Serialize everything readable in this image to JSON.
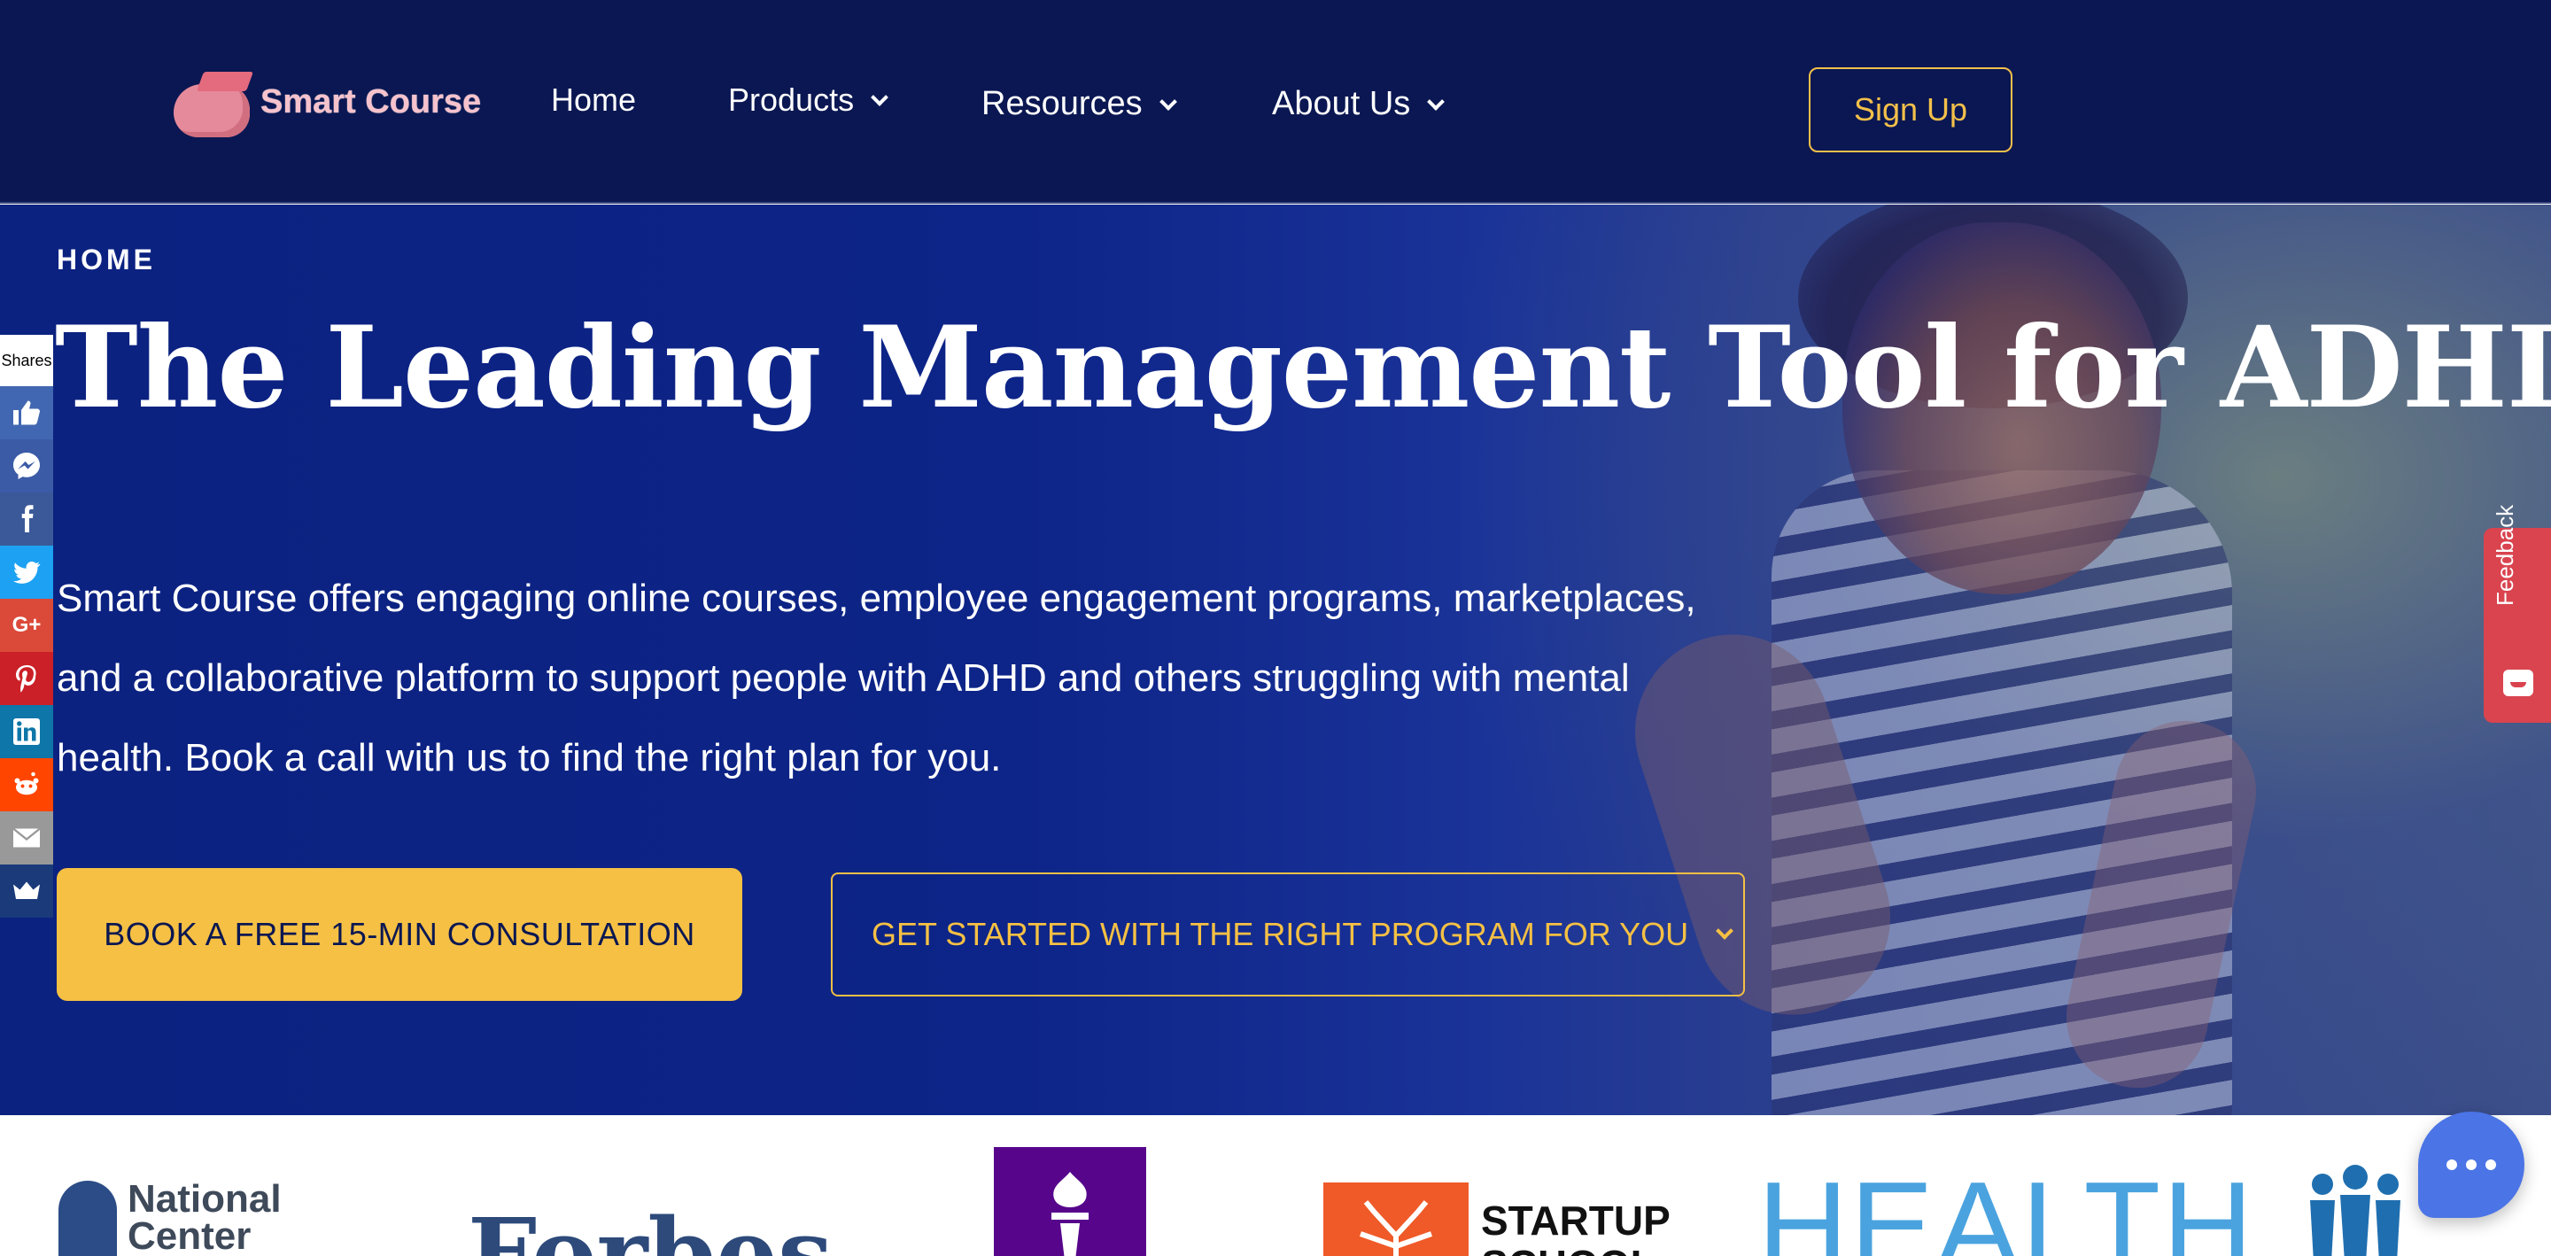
{
  "header": {
    "logo_text": "Smart Course",
    "nav": [
      {
        "label": "Home"
      },
      {
        "label": "Products"
      },
      {
        "label": "Resources"
      },
      {
        "label": "About Us"
      }
    ],
    "signup_label": "Sign Up"
  },
  "hero": {
    "breadcrumb": "HOME",
    "title": "The Leading Management Tool for ADHD",
    "description": "Smart Course offers engaging online courses, employee engagement programs, marketplaces, and a collaborative platform to support people with ADHD and others struggling with mental health. Book a call with us to find the right plan for you.",
    "primary_button": "BOOK A FREE 15-MIN CONSULTATION",
    "secondary_button": "GET STARTED WITH THE RIGHT PROGRAM FOR YOU"
  },
  "sharebar": {
    "count_label": "Shares",
    "buttons": [
      {
        "icon": "like-icon",
        "color": "#4267b2"
      },
      {
        "icon": "messenger-icon",
        "color": "#3b5ba7"
      },
      {
        "icon": "facebook-icon",
        "color": "#3b5998"
      },
      {
        "icon": "twitter-icon",
        "color": "#1da1f2"
      },
      {
        "icon": "google-plus-icon",
        "color": "#db4a39"
      },
      {
        "icon": "pinterest-icon",
        "color": "#cb2027"
      },
      {
        "icon": "linkedin-icon",
        "color": "#0e76a8"
      },
      {
        "icon": "reddit-icon",
        "color": "#ff4500"
      },
      {
        "icon": "email-icon",
        "color": "#999999"
      },
      {
        "icon": "sumo-icon",
        "color": "#1a3a7a"
      }
    ]
  },
  "feedback": {
    "label": "Feedback"
  },
  "logos": {
    "ncfl": "National Center for",
    "forbes": "Forbes",
    "startup": "STARTUP SCHOOL",
    "health": "HEALTH"
  },
  "colors": {
    "header_bg": "#0a1752",
    "hero_bg": "#0c2280",
    "accent_yellow": "#f5c044",
    "feedback_red": "#d9444f",
    "chat_blue": "#4b74e6"
  }
}
